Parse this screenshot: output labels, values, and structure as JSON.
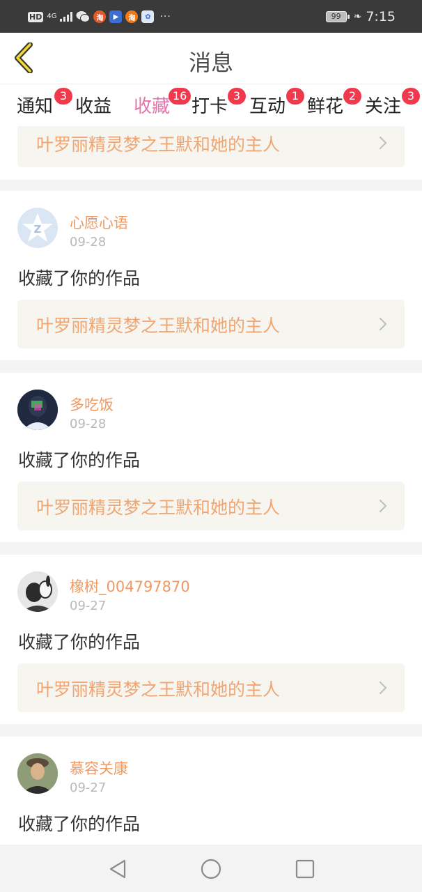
{
  "status_bar": {
    "network": "4G",
    "hd": "HD",
    "battery": "99",
    "time": "7:15",
    "app_icons": [
      "wechat-icon",
      "shopping-app-icon",
      "play-store-icon",
      "taobao-icon",
      "baidu-icon"
    ],
    "overflow": "···"
  },
  "header": {
    "title": "消息"
  },
  "tabs": [
    {
      "label": "通知",
      "badge": "3"
    },
    {
      "label": "收益",
      "badge": ""
    },
    {
      "label": "收藏",
      "badge": "16",
      "active": true
    },
    {
      "label": "打卡",
      "badge": "3"
    },
    {
      "label": "互动",
      "badge": "1"
    },
    {
      "label": "鲜花",
      "badge": "2"
    },
    {
      "label": "关注",
      "badge": "3"
    }
  ],
  "feed": {
    "partial_top": {
      "work_title": "叶罗丽精灵梦之王默和她的主人"
    },
    "items": [
      {
        "username": "心愿心语",
        "date": "09-28",
        "action": "收藏了你的作品",
        "work_title": "叶罗丽精灵梦之王默和她的主人"
      },
      {
        "username": "多吃饭",
        "date": "09-28",
        "action": "收藏了你的作品",
        "work_title": "叶罗丽精灵梦之王默和她的主人"
      },
      {
        "username": "橡树_004797870",
        "date": "09-27",
        "action": "收藏了你的作品",
        "work_title": "叶罗丽精灵梦之王默和她的主人"
      },
      {
        "username": "慕容关康",
        "date": "09-27",
        "action": "收藏了你的作品"
      }
    ]
  },
  "colors": {
    "accent": "#e376ae",
    "badge": "#f0394d",
    "username": "#ee9a63",
    "work_title": "#f0a673"
  }
}
